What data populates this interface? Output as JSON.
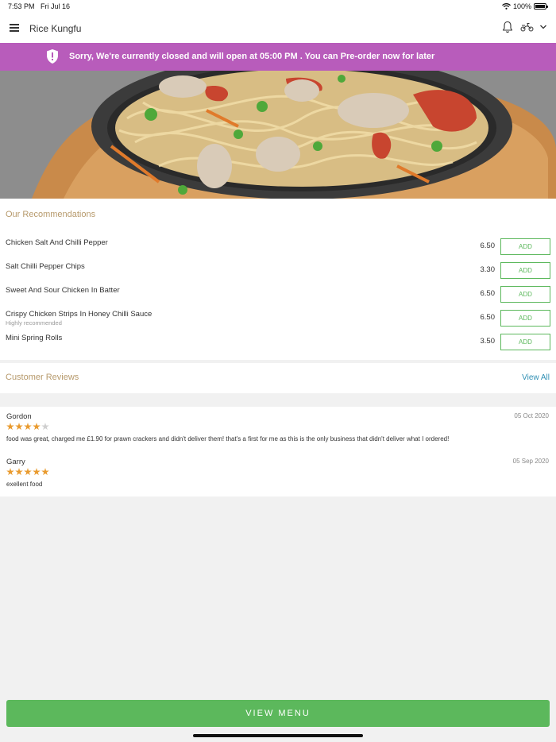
{
  "status_bar": {
    "time": "7:53 PM",
    "date": "Fri Jul 16",
    "battery": "100%"
  },
  "header": {
    "title": "Rice Kungfu"
  },
  "banner": {
    "message": "Sorry, We're currently closed and will open at 05:00 PM . You can Pre-order now for later",
    "color": "#b85cbb"
  },
  "recommendations": {
    "title": "Our Recommendations",
    "items": [
      {
        "name": "Chicken Salt And Chilli Pepper",
        "subtitle": "",
        "price": "6.50",
        "add_label": "ADD"
      },
      {
        "name": "Salt Chilli Pepper Chips",
        "subtitle": "",
        "price": "3.30",
        "add_label": "ADD"
      },
      {
        "name": "Sweet And Sour Chicken In Batter",
        "subtitle": "",
        "price": "6.50",
        "add_label": "ADD"
      },
      {
        "name": "Crispy Chicken Strips In Honey Chilli Sauce",
        "subtitle": "Highly recommended",
        "price": "6.50",
        "add_label": "ADD"
      },
      {
        "name": "Mini Spring Rolls",
        "subtitle": "",
        "price": "3.50",
        "add_label": "ADD"
      }
    ]
  },
  "reviews": {
    "title": "Customer Reviews",
    "view_all_label": "View All",
    "items": [
      {
        "author": "Gordon",
        "date": "05 Oct 2020",
        "rating": 4,
        "text": "food was great, charged me £1.90 for prawn crackers and didn't deliver them! that's a first for me as this is the only business that didn't deliver what I ordered!"
      },
      {
        "author": "Garry",
        "date": "05 Sep 2020",
        "rating": 5,
        "text": "exellent food"
      }
    ]
  },
  "footer": {
    "view_menu_label": "VIEW MENU"
  },
  "colors": {
    "accent_green": "#5cb85c",
    "banner_purple": "#b85cbb",
    "section_title": "#b79a6c",
    "link_blue": "#2f8fb3",
    "star": "#e99b2f"
  },
  "icons": [
    "menu-icon",
    "bell-icon",
    "scooter-icon",
    "chevron-down-icon",
    "shield-alert-icon",
    "wifi-icon",
    "battery-icon",
    "star-icon"
  ]
}
